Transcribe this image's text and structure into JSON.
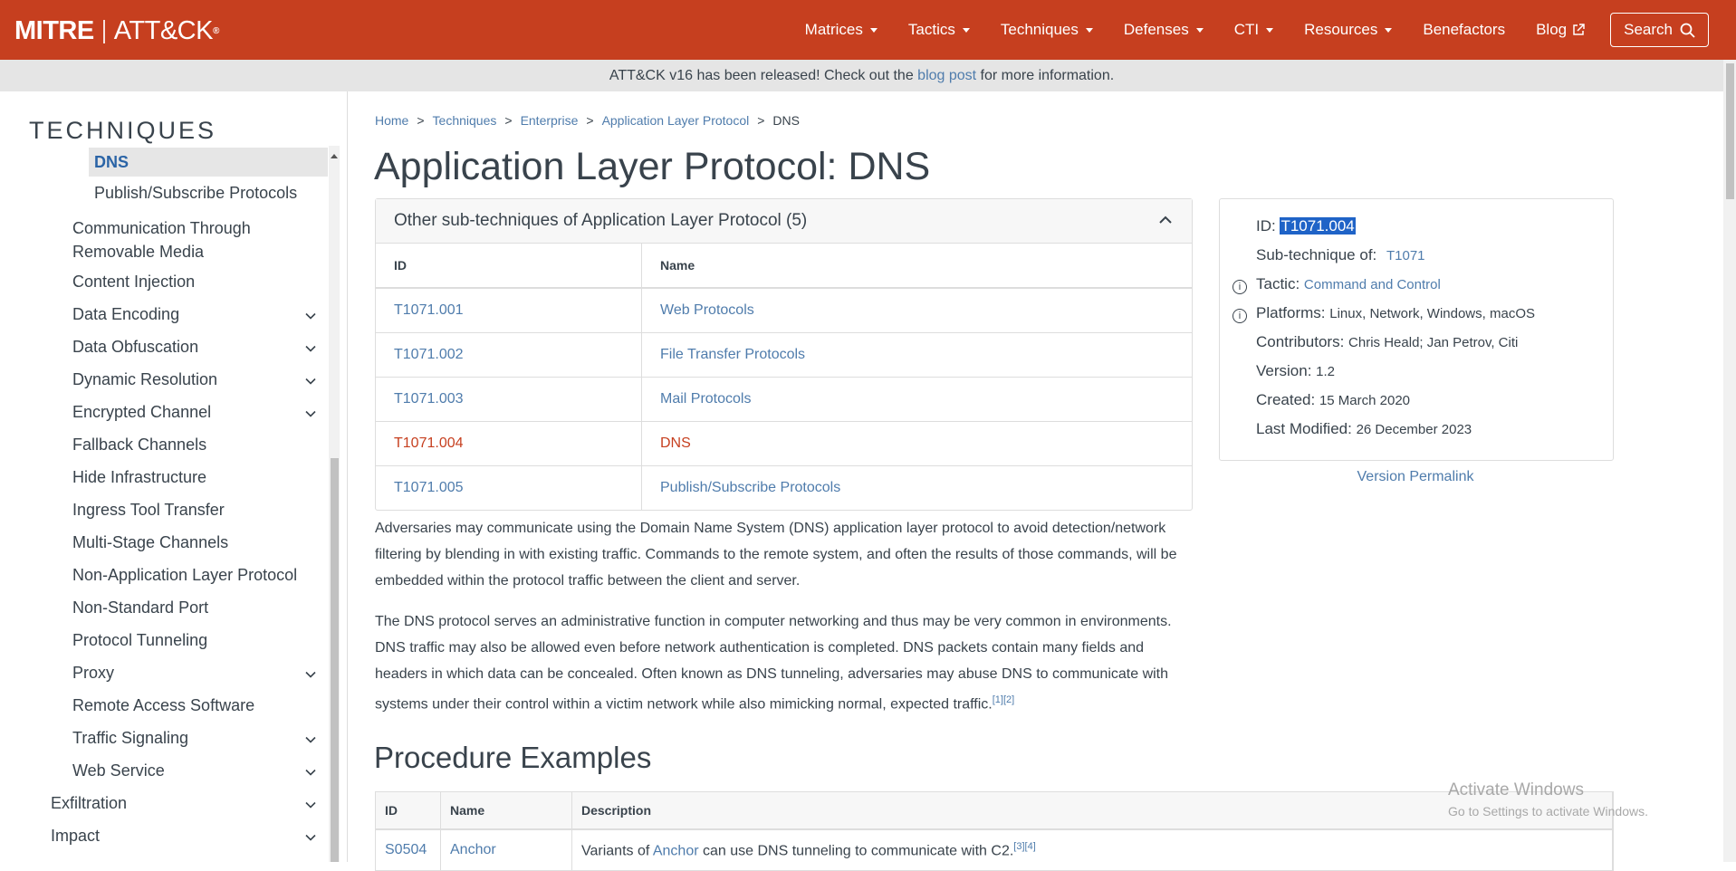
{
  "nav": {
    "logo_left": "MITRE",
    "logo_right": "ATT&CK",
    "logo_reg": "®",
    "items": [
      {
        "label": "Matrices"
      },
      {
        "label": "Tactics"
      },
      {
        "label": "Techniques"
      },
      {
        "label": "Defenses"
      },
      {
        "label": "CTI"
      },
      {
        "label": "Resources"
      },
      {
        "label": "Benefactors"
      },
      {
        "label": "Blog"
      }
    ],
    "search_label": "Search",
    "bg_color": "#c63f1f"
  },
  "banner": {
    "text_before": "ATT&CK v16 has been released! Check out the ",
    "link": "blog post",
    "text_after": " for more information."
  },
  "sidebar": {
    "title": "TECHNIQUES",
    "items": [
      {
        "label": "DNS",
        "active": true,
        "expandable": false
      },
      {
        "label": "Publish/Subscribe Protocols",
        "active": false,
        "expandable": false
      },
      {
        "label": "Communication Through",
        "label2": "Removable Media",
        "expandable": false
      },
      {
        "label": "Content Injection",
        "expandable": false
      },
      {
        "label": "Data Encoding",
        "expandable": true
      },
      {
        "label": "Data Obfuscation",
        "expandable": true
      },
      {
        "label": "Dynamic Resolution",
        "expandable": true
      },
      {
        "label": "Encrypted Channel",
        "expandable": true
      },
      {
        "label": "Fallback Channels",
        "expandable": false
      },
      {
        "label": "Hide Infrastructure",
        "expandable": false
      },
      {
        "label": "Ingress Tool Transfer",
        "expandable": false
      },
      {
        "label": "Multi-Stage Channels",
        "expandable": false
      },
      {
        "label": "Non-Application Layer Protocol",
        "expandable": false
      },
      {
        "label": "Non-Standard Port",
        "expandable": false
      },
      {
        "label": "Protocol Tunneling",
        "expandable": false
      },
      {
        "label": "Proxy",
        "expandable": true
      },
      {
        "label": "Remote Access Software",
        "expandable": false
      },
      {
        "label": "Traffic Signaling",
        "expandable": true
      },
      {
        "label": "Web Service",
        "expandable": true
      },
      {
        "label": "Exfiltration",
        "expandable": true
      },
      {
        "label": "Impact",
        "expandable": true
      }
    ]
  },
  "breadcrumb": [
    "Home",
    "Techniques",
    "Enterprise",
    "Application Layer Protocol",
    "DNS"
  ],
  "page_title": "Application Layer Protocol: DNS",
  "subtechniques": {
    "header": "Other sub-techniques of Application Layer Protocol (5)",
    "columns": [
      "ID",
      "Name"
    ],
    "rows": [
      {
        "id": "T1071.001",
        "name": "Web Protocols"
      },
      {
        "id": "T1071.002",
        "name": "File Transfer Protocols"
      },
      {
        "id": "T1071.003",
        "name": "Mail Protocols"
      },
      {
        "id": "T1071.004",
        "name": "DNS",
        "current": true
      },
      {
        "id": "T1071.005",
        "name": "Publish/Subscribe Protocols"
      }
    ]
  },
  "description": {
    "p1": "Adversaries may communicate using the Domain Name System (DNS) application layer protocol to avoid detection/network filtering by blending in with existing traffic. Commands to the remote system, and often the results of those commands, will be embedded within the protocol traffic between the client and server.",
    "p2": "The DNS protocol serves an administrative function in computer networking and thus may be very common in environments. DNS traffic may also be allowed even before network authentication is completed. DNS packets contain many fields and headers in which data can be concealed. Often known as DNS tunneling, adversaries may abuse DNS to communicate with systems under their control within a victim network while also mimicking normal, expected traffic.",
    "p2_refs": "[1][2]"
  },
  "procedure": {
    "title": "Procedure Examples",
    "columns": [
      "ID",
      "Name",
      "Description"
    ],
    "rows": [
      {
        "id": "S0504",
        "name": "Anchor",
        "desc_before": "Variants of ",
        "desc_link": "Anchor",
        "desc_after": " can use DNS tunneling to communicate with C2.",
        "refs": "[3][4]"
      }
    ]
  },
  "info_card": {
    "id_label": "ID: ",
    "id_value": "T1071.004",
    "subtech_label": "Sub-technique of: ",
    "subtech_value": "T1071",
    "tactic_label": "Tactic: ",
    "tactic_value": "Command and Control",
    "platforms_label": "Platforms: ",
    "platforms_value": "Linux, Network, Windows, macOS",
    "contributors_label": "Contributors: ",
    "contributors_value": "Chris Heald; Jan Petrov, Citi",
    "version_label": "Version: ",
    "version_value": "1.2",
    "created_label": "Created: ",
    "created_value": "15 March 2020",
    "modified_label": "Last Modified: ",
    "modified_value": "26 December 2023",
    "info_glyph": "i"
  },
  "permalink": "Version Permalink",
  "watermark": {
    "line1": "Activate Windows",
    "line2": "Go to Settings to activate Windows."
  }
}
